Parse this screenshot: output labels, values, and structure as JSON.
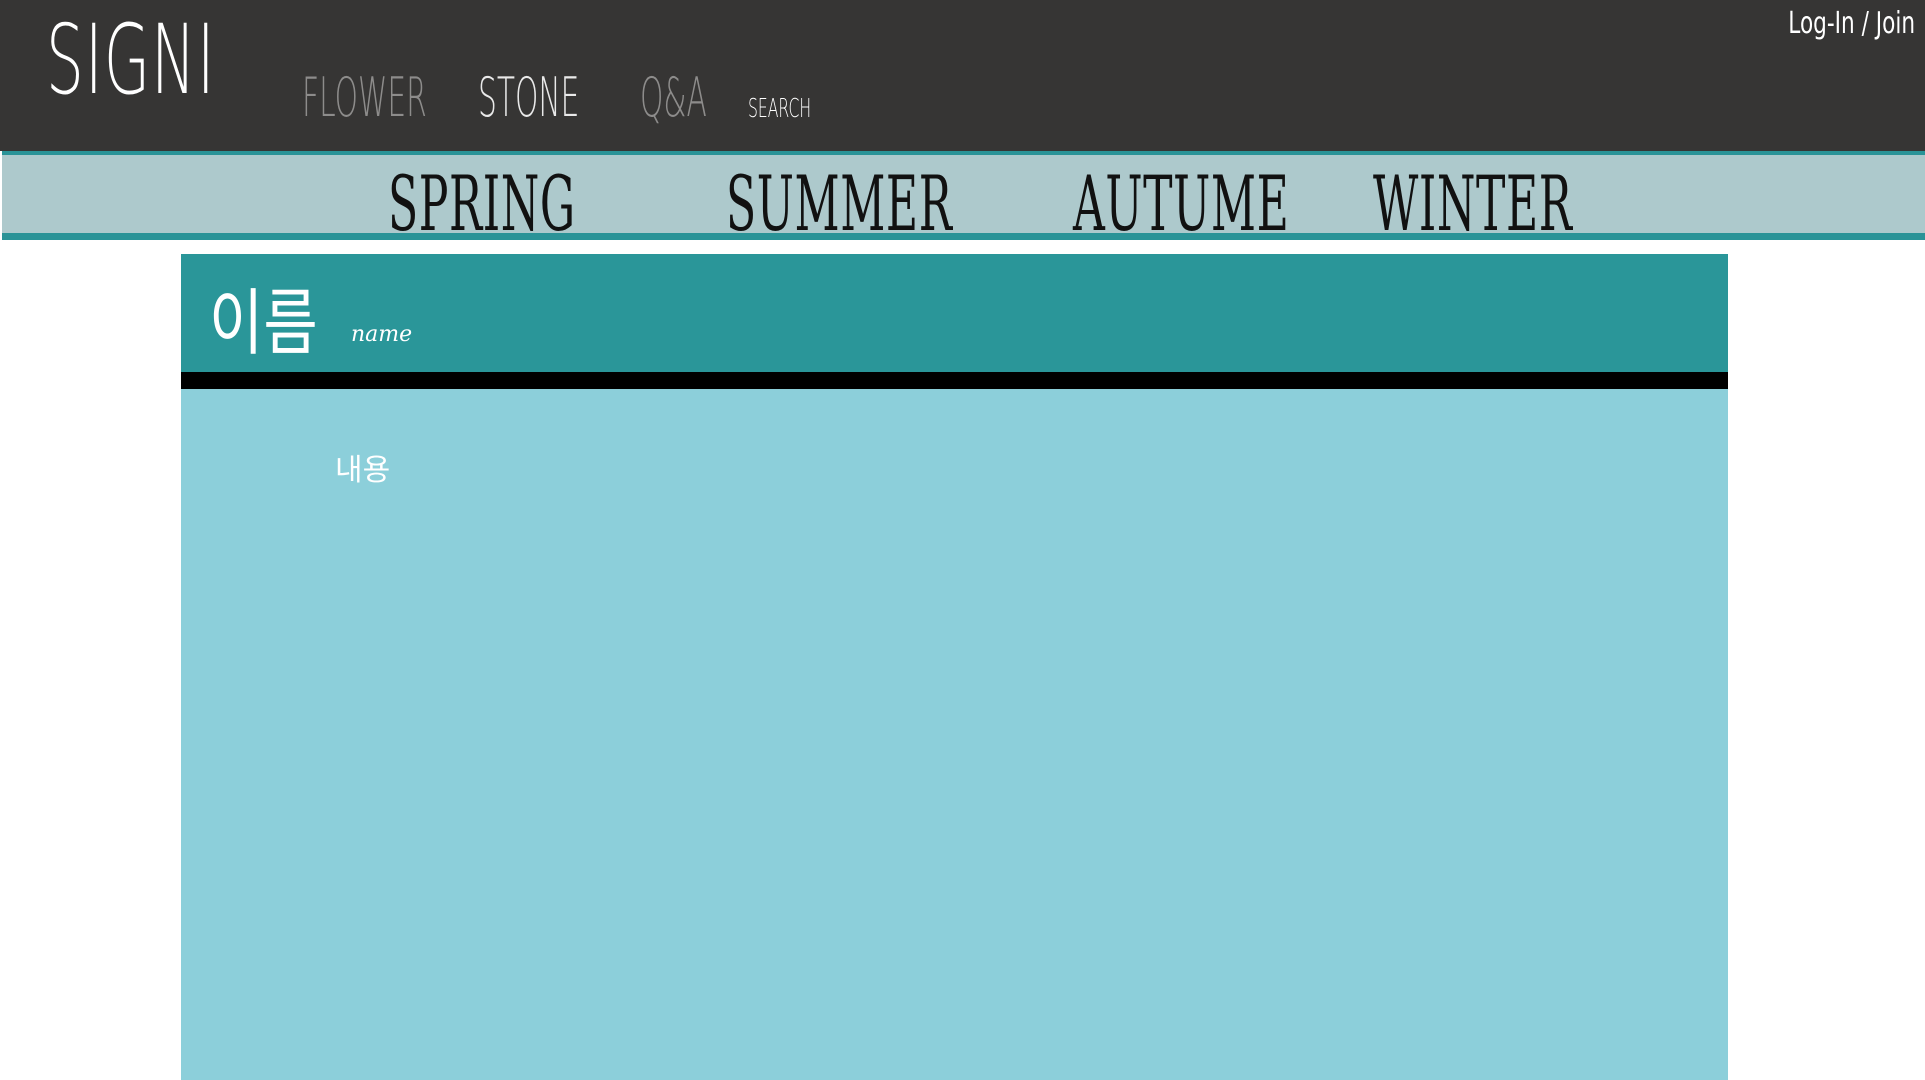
{
  "header": {
    "logo": "SIGNI",
    "nav": {
      "flower": "FLOWER",
      "stone": "STONE",
      "qa": "Q&A",
      "search": "SEARCH"
    },
    "login": "Log-In / Join",
    "colors": {
      "background": "#363534",
      "nav_dim": "#8d8c8b",
      "nav_active": "#e9e9e9"
    }
  },
  "seasons": {
    "items": [
      "SPRING",
      "SUMMER",
      "AUTUME",
      "WINTER"
    ],
    "colors": {
      "background": "#adc9cc",
      "accent": "#2a9397"
    }
  },
  "card": {
    "title": "이름",
    "subtitle": "name",
    "content_label": "내용",
    "colors": {
      "header": "#2a9699",
      "divider": "#000000",
      "body": "#8ccfda"
    }
  }
}
